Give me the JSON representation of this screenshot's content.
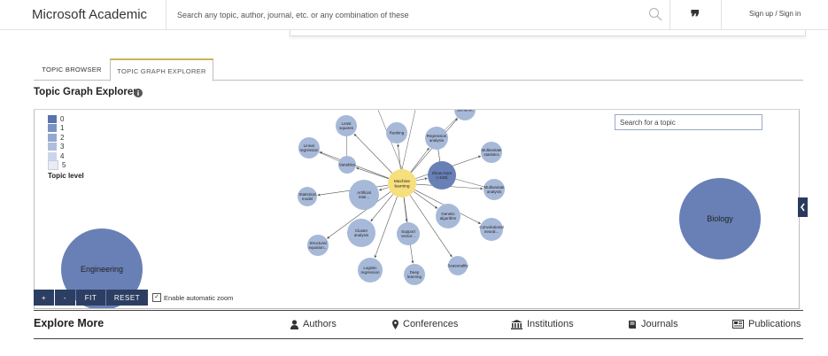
{
  "header": {
    "brand": "Microsoft Academic",
    "search_placeholder": "Search any topic, author, journal, etc. or any combination of these",
    "sign_in": "Sign up / Sign in",
    "quote_glyph": "❞"
  },
  "tabs": [
    {
      "label": "TOPIC BROWSER",
      "active": false
    },
    {
      "label": "TOPIC GRAPH EXPLORER",
      "active": true
    }
  ],
  "page_title": "Topic Graph Explorer",
  "legend": {
    "levels": [
      "0",
      "1",
      "2",
      "3",
      "4",
      "5"
    ],
    "title": "Topic level"
  },
  "topic_search_placeholder": "Search for a topic",
  "graph": {
    "center": "Machine learning",
    "nodes": [
      {
        "lines": [
          "Least",
          "squares"
        ]
      },
      {
        "lines": [
          "Ranking"
        ]
      },
      {
        "lines": [
          "Regression",
          "analysis"
        ]
      },
      {
        "lines": [
          "Linear",
          "regression"
        ]
      },
      {
        "lines": [
          "Variables"
        ]
      },
      {
        "lines": [
          "Multivariate",
          "statistics"
        ]
      },
      {
        "lines": [
          "Show more",
          "(+100)"
        ]
      },
      {
        "lines": [
          "Multivariate",
          "analysis"
        ]
      },
      {
        "lines": [
          "Statistical",
          "model"
        ]
      },
      {
        "lines": [
          "Artificial",
          "intel..."
        ]
      },
      {
        "lines": [
          "Genetic",
          "algorithm"
        ]
      },
      {
        "lines": [
          "Convolutional",
          "neural..."
        ]
      },
      {
        "lines": [
          "Cluster",
          "analysis"
        ]
      },
      {
        "lines": [
          "Support",
          "vector..."
        ]
      },
      {
        "lines": [
          "Structural",
          "equation..."
        ]
      },
      {
        "lines": [
          "Seasonality"
        ]
      },
      {
        "lines": [
          "Logistic",
          "regression"
        ]
      },
      {
        "lines": [
          "Deep",
          "learning"
        ]
      },
      {
        "lines": [
          "Semantic",
          ""
        ]
      },
      {
        "lines": [
          "Biology"
        ]
      },
      {
        "lines": [
          "Engineering"
        ]
      }
    ]
  },
  "controls": {
    "zoom_in": "+",
    "zoom_out": "-",
    "fit": "FIT",
    "reset": "RESET",
    "auto_zoom_label": "Enable automatic zoom",
    "auto_zoom_checked": true
  },
  "explore": {
    "title": "Explore More",
    "links": [
      {
        "label": "Authors",
        "icon": "person-icon"
      },
      {
        "label": "Conferences",
        "icon": "map-pin-icon"
      },
      {
        "label": "Institutions",
        "icon": "institution-icon"
      },
      {
        "label": "Journals",
        "icon": "book-icon"
      },
      {
        "label": "Publications",
        "icon": "newspaper-icon"
      }
    ]
  },
  "colors": {
    "accent_dark": "#2c3e62",
    "node_primary": "#6880b5",
    "node_level3": "#a7b9d8",
    "node_center": "#f6df7c",
    "tab_active_border": "#c9b35a"
  }
}
